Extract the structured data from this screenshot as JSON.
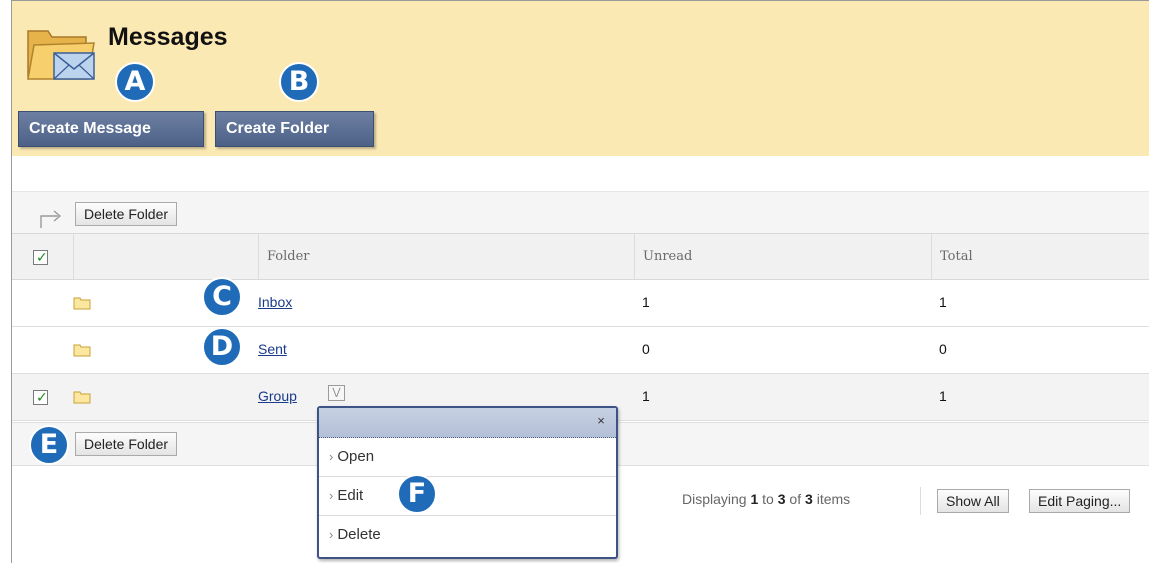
{
  "header": {
    "title": "Messages",
    "create_message": "Create Message",
    "create_folder": "Create Folder"
  },
  "callouts": {
    "a": "A",
    "b": "B",
    "c": "C",
    "d": "D",
    "e": "E",
    "f": "F"
  },
  "toolbar": {
    "delete_folder_top": "Delete Folder",
    "delete_folder_bottom": "Delete Folder"
  },
  "table": {
    "columns": [
      "Folder",
      "Unread",
      "Total"
    ],
    "rows": [
      {
        "folder": "Inbox",
        "unread": "1",
        "total": "1",
        "checked": false
      },
      {
        "folder": "Sent",
        "unread": "0",
        "total": "0",
        "checked": false
      },
      {
        "folder": "Group",
        "unread": "1",
        "total": "1",
        "checked": true
      }
    ]
  },
  "context_menu": {
    "close": "×",
    "items": [
      "Open",
      "Edit",
      "Delete"
    ]
  },
  "paging": {
    "prefix": "Displaying ",
    "from": "1",
    "to_word": " to ",
    "to": "3",
    "of_word": " of ",
    "total": "3",
    "suffix": " items",
    "show_all": "Show All",
    "edit_paging": "Edit Paging..."
  },
  "colors": {
    "header_bg": "#fbe9b4",
    "button_blue": "#5a6d93",
    "callout_blue": "#1f6bb8",
    "link": "#1a3a8a"
  }
}
